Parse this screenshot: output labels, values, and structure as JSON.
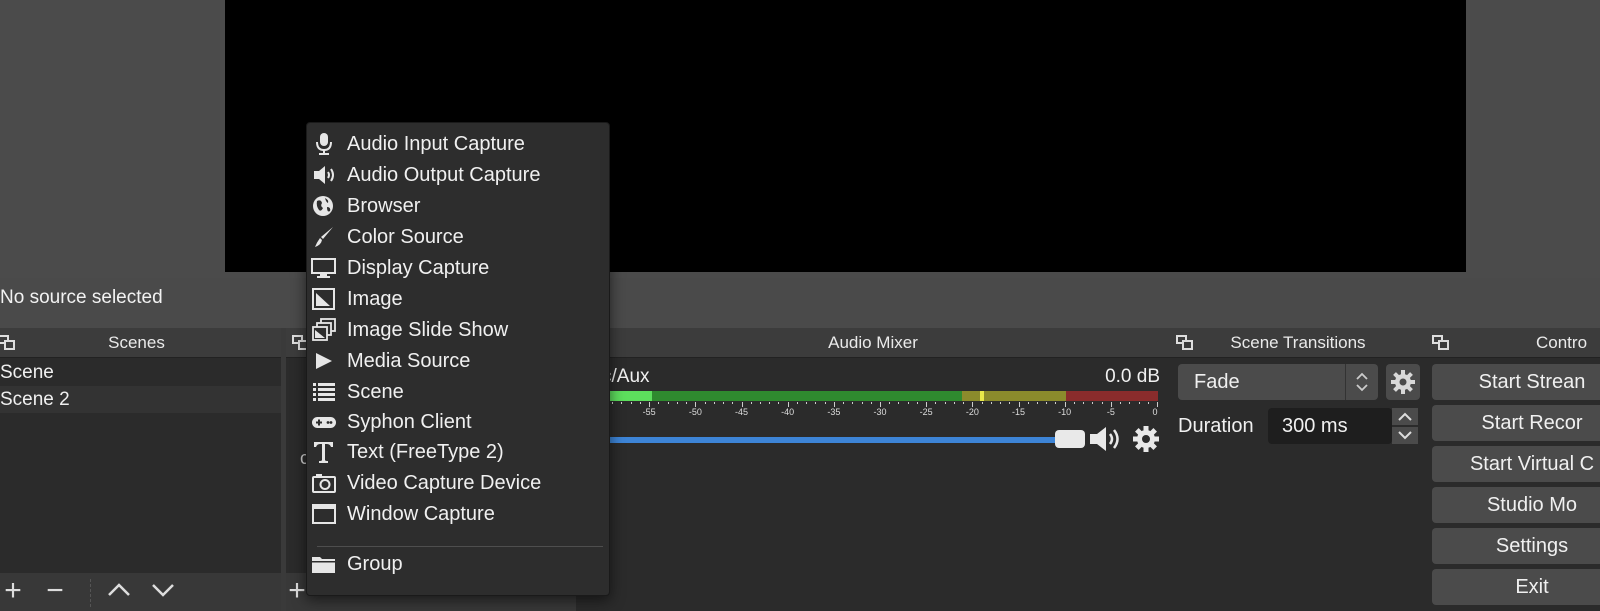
{
  "status": {
    "source_selected": "No source selected"
  },
  "scenes": {
    "title": "Scenes",
    "items": [
      {
        "label": "Scene"
      },
      {
        "label": "Scene 2"
      }
    ],
    "footer": {
      "add": "+",
      "remove": "−",
      "up": "∧",
      "down": "∨"
    }
  },
  "sources": {
    "partial_visible_text": "c",
    "footer_add": "+"
  },
  "mixer": {
    "title": "Audio Mixer",
    "channel": {
      "name": "c/Aux",
      "db": "0.0 dB",
      "volume_fraction": 0.93
    },
    "scale": [
      "-55",
      "-50",
      "-45",
      "-40",
      "-35",
      "-30",
      "-25",
      "-20",
      "-15",
      "-10",
      "-5",
      "0"
    ]
  },
  "transitions": {
    "title": "Scene Transitions",
    "selected": "Fade",
    "duration_label": "Duration",
    "duration_value": "300 ms"
  },
  "controls": {
    "title": "Contro",
    "buttons": [
      {
        "label": "Start Strean"
      },
      {
        "label": "Start Recor"
      },
      {
        "label": "Start Virtual C"
      },
      {
        "label": "Studio Mo"
      },
      {
        "label": "Settings"
      },
      {
        "label": "Exit"
      }
    ]
  },
  "context_menu": {
    "items": [
      {
        "label": "Audio Input Capture",
        "icon": "microphone-icon"
      },
      {
        "label": "Audio Output Capture",
        "icon": "speaker-icon"
      },
      {
        "label": "Browser",
        "icon": "globe-icon"
      },
      {
        "label": "Color Source",
        "icon": "brush-icon"
      },
      {
        "label": "Display Capture",
        "icon": "monitor-icon"
      },
      {
        "label": "Image",
        "icon": "image-icon"
      },
      {
        "label": "Image Slide Show",
        "icon": "slideshow-icon"
      },
      {
        "label": "Media Source",
        "icon": "play-icon"
      },
      {
        "label": "Scene",
        "icon": "list-icon"
      },
      {
        "label": "Syphon Client",
        "icon": "gamepad-icon"
      },
      {
        "label": "Text (FreeType 2)",
        "icon": "text-icon"
      },
      {
        "label": "Video Capture Device",
        "icon": "camera-icon"
      },
      {
        "label": "Window Capture",
        "icon": "window-icon"
      }
    ],
    "group": {
      "label": "Group",
      "icon": "folder-icon"
    }
  },
  "colors": {
    "meter_green": "#3fbf3f",
    "meter_yellow": "#c8c83a",
    "meter_red": "#c83a3a",
    "volume_blue": "#3d84d6"
  }
}
